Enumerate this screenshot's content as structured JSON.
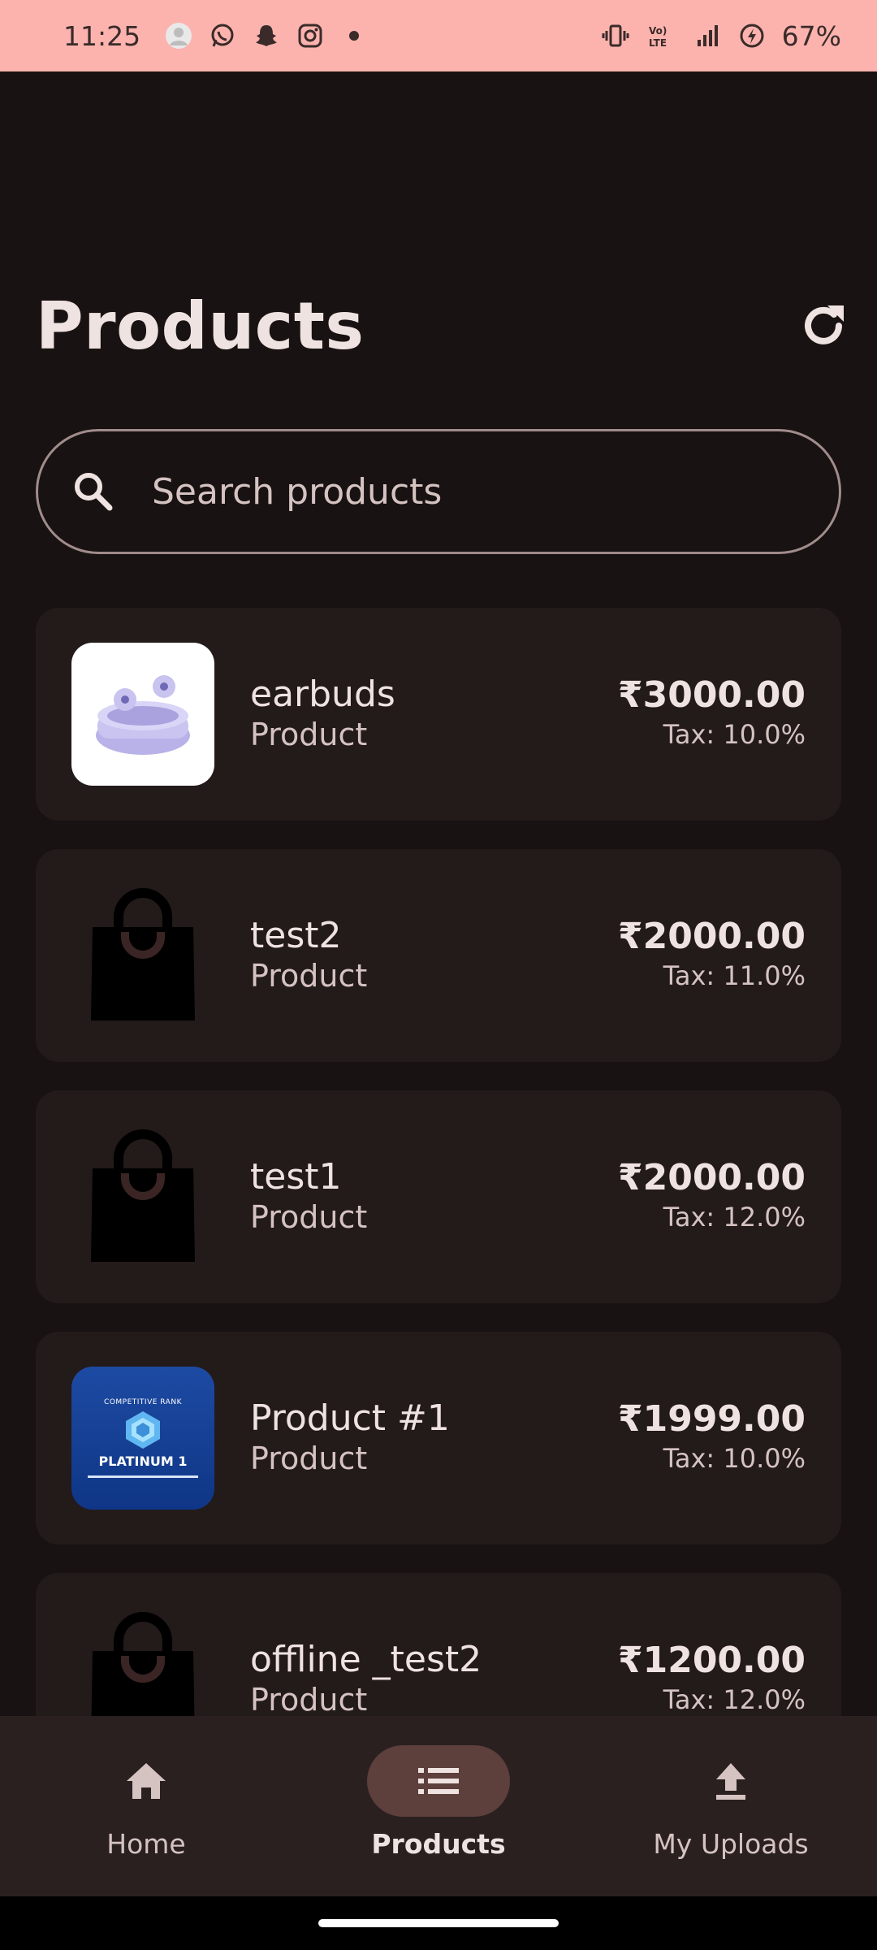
{
  "status_bar": {
    "time": "11:25",
    "battery": "67%",
    "left_icons": [
      "avatar-icon",
      "whatsapp-icon",
      "snapchat-icon",
      "instagram-icon",
      "dot-icon"
    ],
    "right_icons": [
      "vibrate-icon",
      "volte-icon",
      "signal-icon",
      "battery-saver-icon"
    ],
    "volte_text": "Vo) LTE"
  },
  "header": {
    "title": "Products"
  },
  "search": {
    "placeholder": "Search products"
  },
  "products": [
    {
      "name": "earbuds",
      "type": "Product",
      "price": "₹3000.00",
      "tax": "Tax: 10.0%",
      "image": "earbuds"
    },
    {
      "name": "test2",
      "type": "Product",
      "price": "₹2000.00",
      "tax": "Tax: 11.0%",
      "image": "bag"
    },
    {
      "name": "test1",
      "type": "Product",
      "price": "₹2000.00",
      "tax": "Tax: 12.0%",
      "image": "bag"
    },
    {
      "name": "Product #1",
      "type": "Product",
      "price": "₹1999.00",
      "tax": "Tax: 10.0%",
      "image": "platinum",
      "image_text": {
        "header": "COMPETITIVE RANK",
        "title": "PLATINUM 1"
      }
    },
    {
      "name": "offline _test2",
      "type": "Product",
      "price": "₹1200.00",
      "tax": "Tax: 12.0%",
      "image": "bag"
    }
  ],
  "bottom_nav": {
    "items": [
      {
        "label": "Home",
        "icon": "home-icon",
        "active": false
      },
      {
        "label": "Products",
        "icon": "list-icon",
        "active": true
      },
      {
        "label": "My Uploads",
        "icon": "upload-icon",
        "active": false
      }
    ]
  },
  "colors": {
    "status_bar_bg": "#fcb3ae",
    "background": "#181212",
    "card_bg": "#231a1a",
    "nav_bg": "#2a2020",
    "nav_active_pill": "#5d3f3c",
    "text_primary": "#efe3e1",
    "text_secondary": "#d5c3c1"
  }
}
